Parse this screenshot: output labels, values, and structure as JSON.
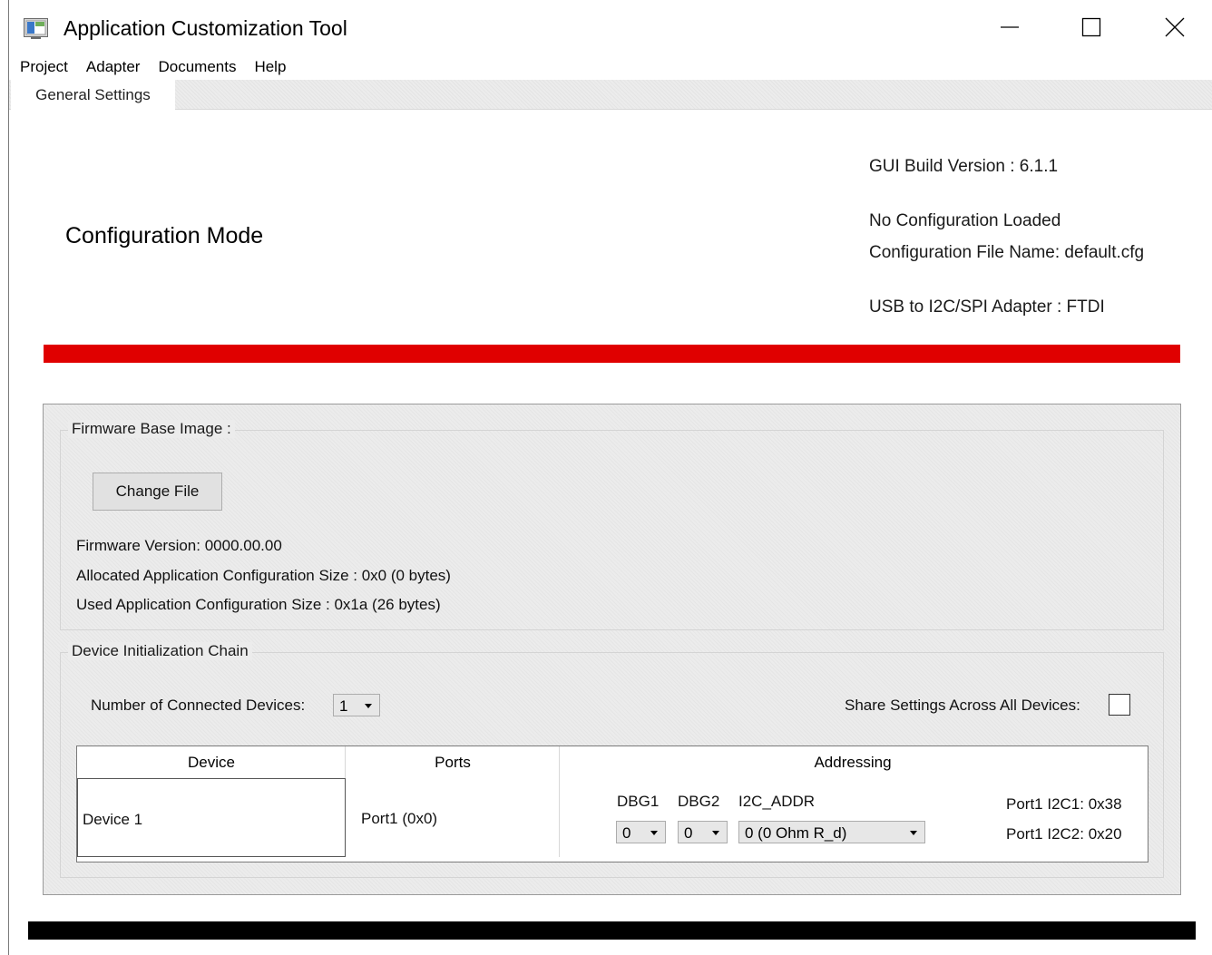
{
  "window": {
    "title": "Application Customization Tool"
  },
  "menu": {
    "items": [
      "Project",
      "Adapter",
      "Documents",
      "Help"
    ]
  },
  "tabs": [
    {
      "label": "General Settings",
      "active": true
    }
  ],
  "header": {
    "mode_title": "Configuration Mode",
    "gui_build_version": "GUI Build Version : 6.1.1",
    "config_status": "No Configuration Loaded",
    "config_file": "Configuration File Name: default.cfg",
    "adapter": "USB to I2C/SPI Adapter : FTDI"
  },
  "firmware": {
    "group_label": "Firmware Base Image :",
    "change_file_button": "Change File",
    "version": "Firmware Version:   0000.00.00",
    "allocated_size": "Allocated Application Configuration Size :   0x0 (0 bytes)",
    "used_size": "Used Application Configuration Size :   0x1a (26 bytes)"
  },
  "device_chain": {
    "group_label": "Device Initialization Chain",
    "num_devices_label": "Number of Connected Devices:",
    "num_devices_value": "1",
    "share_settings_label": "Share Settings Across All Devices:",
    "table": {
      "headers": [
        "Device",
        "Ports",
        "Addressing"
      ],
      "rows": [
        {
          "device": "Device 1",
          "ports": "Port1 (0x0)",
          "dbg1_label": "DBG1",
          "dbg2_label": "DBG2",
          "i2c_addr_label": "I2C_ADDR",
          "dbg1_value": "0",
          "dbg2_value": "0",
          "i2c_addr_value": "0 (0 Ohm R_d)",
          "i2c1": "Port1 I2C1: 0x38",
          "i2c2": "Port1 I2C2: 0x20"
        }
      ]
    }
  },
  "colors": {
    "status_bar": "#e00000",
    "footer_bar": "#000000"
  }
}
